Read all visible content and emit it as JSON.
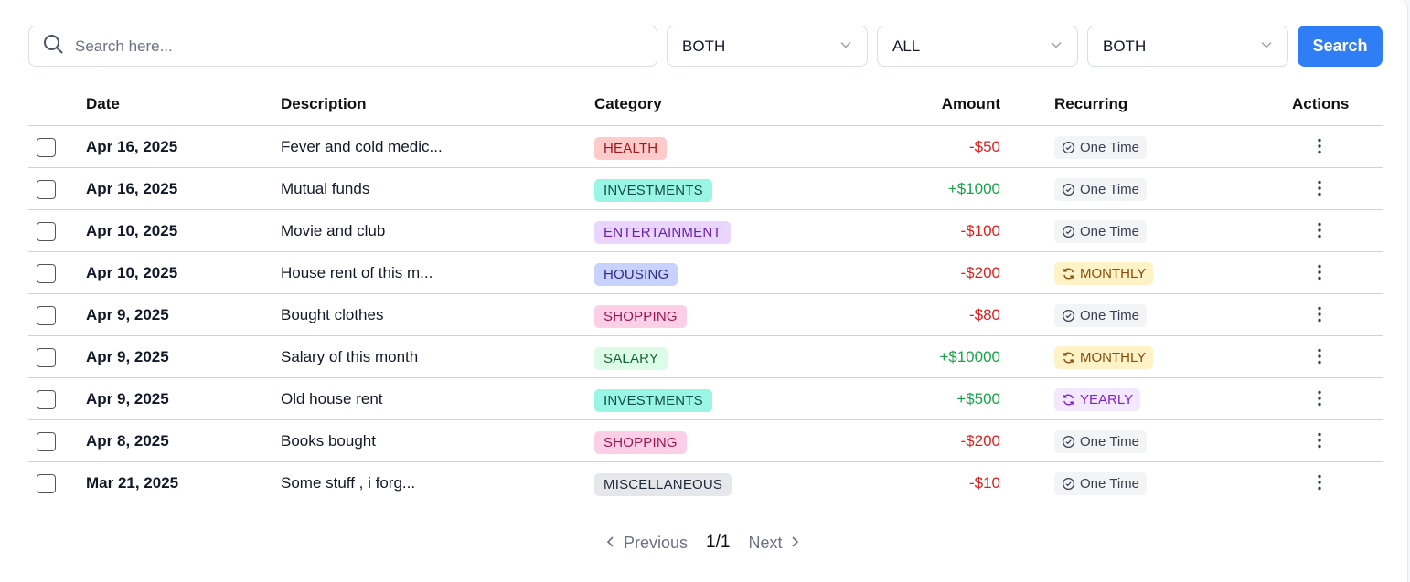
{
  "search": {
    "placeholder": "Search here...",
    "button_label": "Search"
  },
  "filters": [
    {
      "value": "BOTH"
    },
    {
      "value": "ALL"
    },
    {
      "value": "BOTH"
    }
  ],
  "table": {
    "headers": {
      "date": "Date",
      "description": "Description",
      "category": "Category",
      "amount": "Amount",
      "recurring": "Recurring",
      "actions": "Actions"
    },
    "rows": [
      {
        "date": "Apr 16, 2025",
        "description": "Fever and cold medic...",
        "category": "HEALTH",
        "amount": "-$50",
        "recurring": "One Time"
      },
      {
        "date": "Apr 16, 2025",
        "description": "Mutual funds",
        "category": "INVESTMENTS",
        "amount": "+$1000",
        "recurring": "One Time"
      },
      {
        "date": "Apr 10, 2025",
        "description": "Movie and club",
        "category": "ENTERTAINMENT",
        "amount": "-$100",
        "recurring": "One Time"
      },
      {
        "date": "Apr 10, 2025",
        "description": "House rent of this m...",
        "category": "HOUSING",
        "amount": "-$200",
        "recurring": "MONTHLY"
      },
      {
        "date": "Apr 9, 2025",
        "description": "Bought clothes",
        "category": "SHOPPING",
        "amount": "-$80",
        "recurring": "One Time"
      },
      {
        "date": "Apr 9, 2025",
        "description": "Salary of this month",
        "category": "SALARY",
        "amount": "+$10000",
        "recurring": "MONTHLY"
      },
      {
        "date": "Apr 9, 2025",
        "description": "Old house rent",
        "category": "INVESTMENTS",
        "amount": "+$500",
        "recurring": "YEARLY"
      },
      {
        "date": "Apr 8, 2025",
        "description": "Books bought",
        "category": "SHOPPING",
        "amount": "-$200",
        "recurring": "One Time"
      },
      {
        "date": "Mar 21, 2025",
        "description": "Some stuff , i forg...",
        "category": "MISCELLANEOUS",
        "amount": "-$10",
        "recurring": "One Time"
      }
    ]
  },
  "pagination": {
    "previous": "Previous",
    "page": "1/1",
    "next": "Next"
  },
  "colors": {
    "primary": "#2f7ef5",
    "negative": "#dc1f1f",
    "positive": "#16a34a",
    "category": {
      "HEALTH": {
        "bg": "#fecaca",
        "fg": "#991b1b"
      },
      "INVESTMENTS": {
        "bg": "#99f6e4",
        "fg": "#134e4a"
      },
      "ENTERTAINMENT": {
        "bg": "#e9d5ff",
        "fg": "#6b21a8"
      },
      "HOUSING": {
        "bg": "#c7d2fe",
        "fg": "#312e81"
      },
      "SHOPPING": {
        "bg": "#fbcfe8",
        "fg": "#9d174d"
      },
      "SALARY": {
        "bg": "#dcfce7",
        "fg": "#166534"
      },
      "MISCELLANEOUS": {
        "bg": "#e5e7eb",
        "fg": "#1f2937"
      }
    },
    "recurring": {
      "One Time": {
        "bg": "#f3f4f6",
        "fg": "#374151"
      },
      "MONTHLY": {
        "bg": "#fef3c7",
        "fg": "#854d0e"
      },
      "YEARLY": {
        "bg": "#f3e8ff",
        "fg": "#7e22ce"
      }
    }
  }
}
